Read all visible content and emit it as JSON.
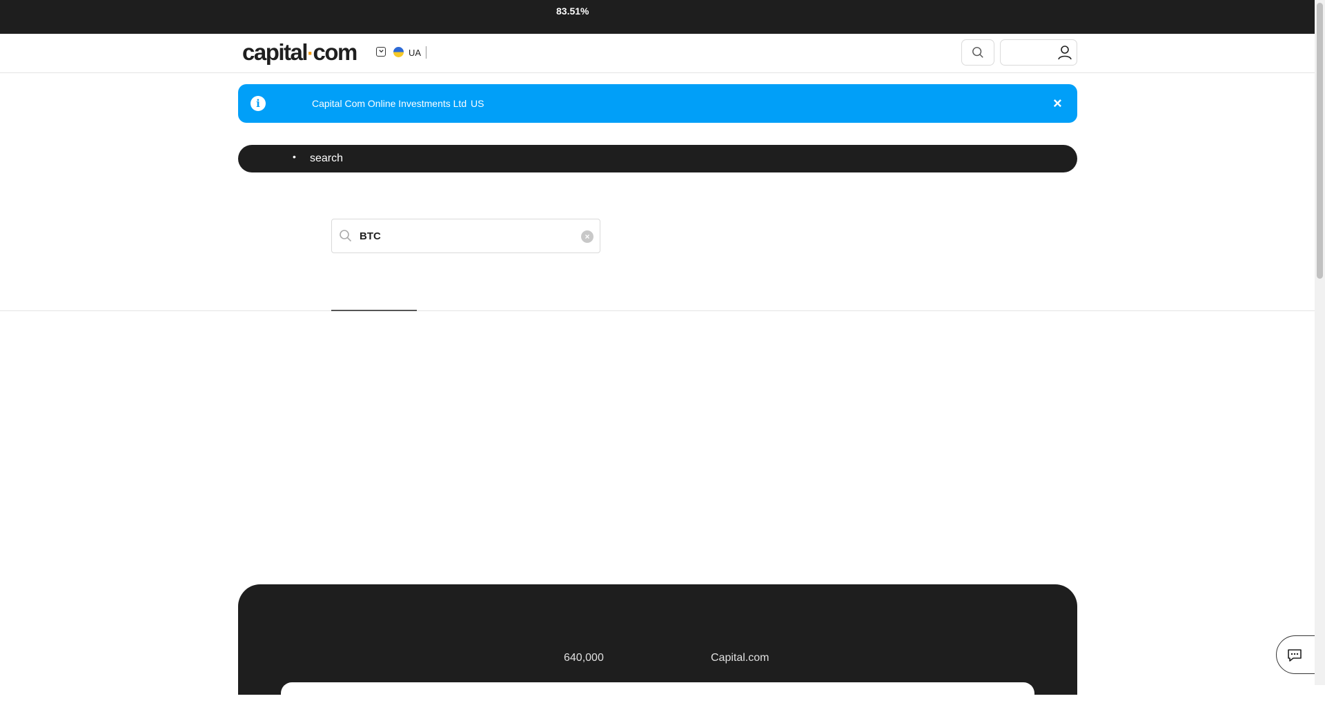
{
  "topbar": {
    "percent": "83.51%"
  },
  "header": {
    "logo_left": "capital",
    "logo_dot": "·",
    "logo_right": "com",
    "country": "UA",
    "icons": {
      "search": "search-icon",
      "account": "user-icon",
      "toggle": "chevron-down-icon"
    }
  },
  "banner": {
    "company": "Capital Com Online Investments Ltd",
    "region": "US",
    "close": "×",
    "color": "#019ff8"
  },
  "search_bar": {
    "bullet": "•",
    "label": "search"
  },
  "search_field": {
    "value": "BTC",
    "clear": "×"
  },
  "footer": {
    "count": "640,000",
    "brand": "Capital.com"
  },
  "colors": {
    "dark": "#1e1e1e",
    "accent": "#f39c12"
  }
}
